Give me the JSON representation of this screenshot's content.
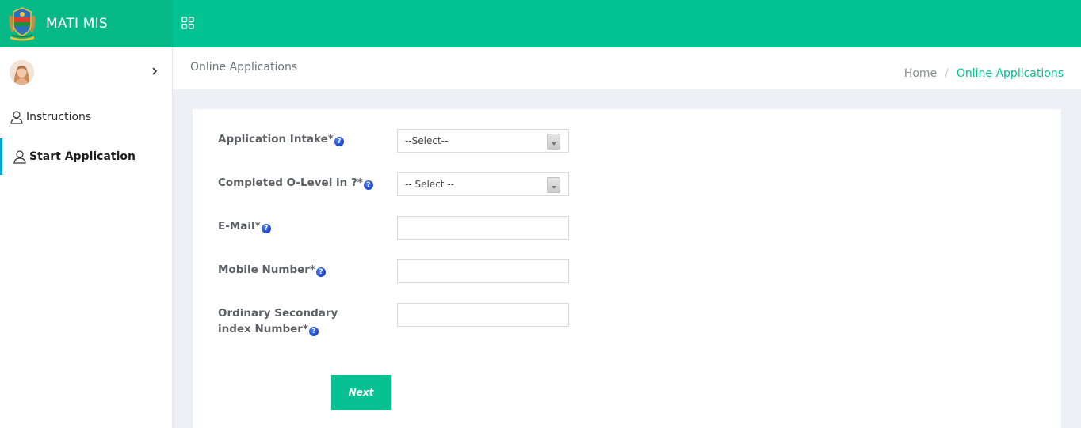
{
  "app": {
    "brand": "MATI MIS",
    "logo_icon": "tanzania-coat-of-arms",
    "menu_icon": "grid-icon"
  },
  "colors": {
    "topbar": "#04c393",
    "brand_bg": "#08b988",
    "accent": "#04c393",
    "active_nav_border": "#04a7c7",
    "button": "#07c193"
  },
  "sidebar": {
    "user_chevron_icon": "chevron-right-icon",
    "items": [
      {
        "label": "Instructions",
        "icon": "user-icon",
        "active": false
      },
      {
        "label": "Start Application",
        "icon": "user-icon",
        "active": true
      }
    ]
  },
  "header": {
    "title": "Online Applications",
    "breadcrumb": {
      "home": "Home",
      "separator": "/",
      "current": "Online Applications"
    }
  },
  "form": {
    "fields": [
      {
        "label": "Application Intake*",
        "type": "select",
        "value": "--Select--"
      },
      {
        "label": "Completed O-Level in ?*",
        "type": "select",
        "value": "-- Select --"
      },
      {
        "label": "E-Mail*",
        "type": "text",
        "value": ""
      },
      {
        "label": "Mobile Number*",
        "type": "text",
        "value": ""
      },
      {
        "label": "Ordinary Secondary index Number*",
        "type": "text",
        "value": ""
      }
    ],
    "help_icon": "question-icon",
    "help_glyph": "?",
    "next_label": "Next"
  }
}
